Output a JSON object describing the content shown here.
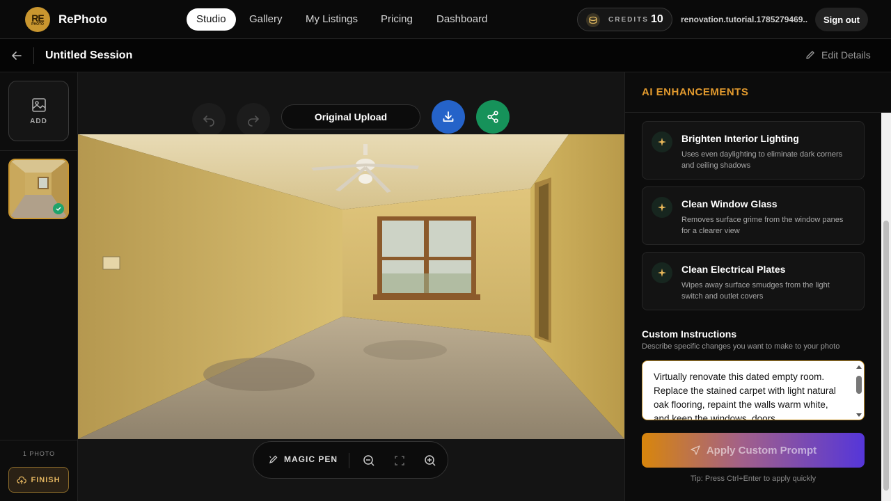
{
  "brand": {
    "name": "RePhoto",
    "logo_text": "RE",
    "logo_sub": "PHOTO"
  },
  "nav": {
    "tabs": [
      {
        "label": "Studio",
        "active": true
      },
      {
        "label": "Gallery"
      },
      {
        "label": "My Listings"
      },
      {
        "label": "Pricing"
      },
      {
        "label": "Dashboard"
      }
    ],
    "credits_label": "CREDITS",
    "credits_value": "10",
    "user_email": "renovation.tutorial.1785279469...",
    "signout": "Sign out"
  },
  "session": {
    "title": "Untitled Session",
    "edit_label": "Edit Details"
  },
  "leftrail": {
    "add_label": "ADD",
    "photo_count": "1 PHOTO",
    "finish_label": "FINISH"
  },
  "canvas": {
    "version_label": "Original Upload",
    "magic_pen": "MAGIC PEN"
  },
  "panel": {
    "title": "AI ENHANCEMENTS",
    "enhancements": [
      {
        "title": "Brighten Interior Lighting",
        "desc": "Uses even daylighting to eliminate dark corners and ceiling shadows"
      },
      {
        "title": "Clean Window Glass",
        "desc": "Removes surface grime from the window panes for a clearer view"
      },
      {
        "title": "Clean Electrical Plates",
        "desc": "Wipes away surface smudges from the light switch and outlet covers"
      }
    ],
    "custom_title": "Custom Instructions",
    "custom_sub": "Describe specific changes you want to make to your photo",
    "custom_text": "Virtually renovate this dated empty room. Replace the stained carpet with light natural oak flooring, repaint the walls warm white, and keep the windows, doors",
    "apply_label": "Apply Custom Prompt",
    "tip": "Tip: Press Ctrl+Enter to apply quickly"
  },
  "colors": {
    "accent": "#c9962f",
    "download": "#2563c9",
    "share": "#16925a",
    "panel_title": "#e29a2e"
  }
}
